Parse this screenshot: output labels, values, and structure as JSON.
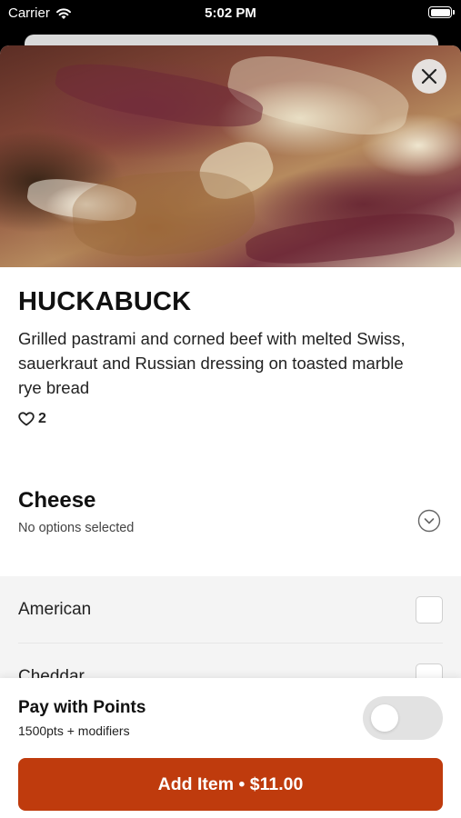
{
  "status_bar": {
    "carrier": "Carrier",
    "time": "5:02 PM"
  },
  "item": {
    "name": "HUCKABUCK",
    "description": "Grilled pastrami and corned beef with melted Swiss, sauerkraut and Russian dressing on toasted marble rye bread",
    "likes": "2"
  },
  "modifier_group": {
    "title": "Cheese",
    "subtitle": "No options selected",
    "options": [
      {
        "label": "American",
        "selected": false
      },
      {
        "label": "Cheddar",
        "selected": false
      }
    ]
  },
  "footer": {
    "points_title": "Pay with Points",
    "points_subtitle": "1500pts + modifiers",
    "points_enabled": false,
    "add_button_label": "Add Item • $11.00"
  },
  "colors": {
    "accent": "#bf3b0d",
    "toggle_off": "#e2e2e2"
  }
}
